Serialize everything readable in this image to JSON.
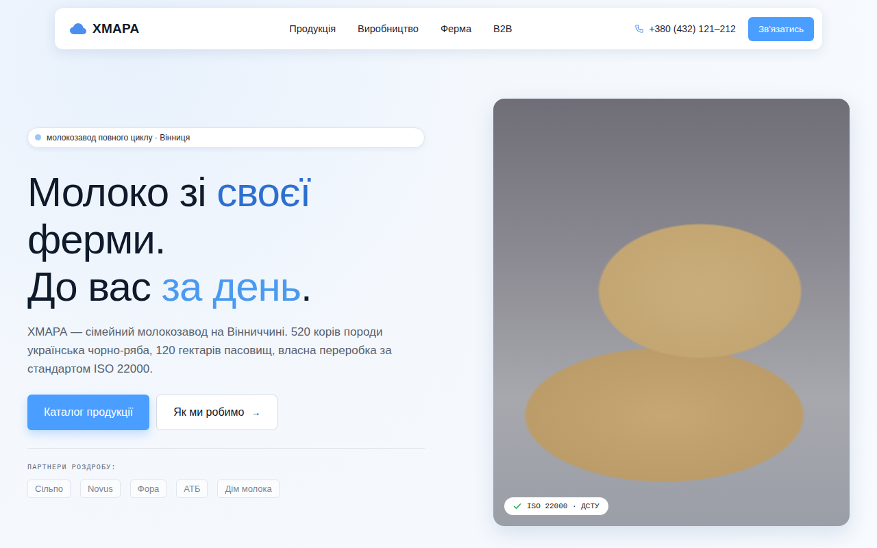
{
  "header": {
    "logo": "ХМАРА",
    "nav": [
      "Продукція",
      "Виробництво",
      "Ферма",
      "B2B"
    ],
    "phone": "+380 (432) 121–212",
    "cta": "Зв'язатись"
  },
  "hero": {
    "badge": "молокозавод повного циклу · Вінниця",
    "title": [
      [
        {
          "text": "Молоко зі ",
          "color": "#0f1a2b"
        },
        {
          "text": "своєї",
          "color": "#2d6fcf"
        }
      ],
      [
        {
          "text": "ферми.",
          "color": "#0f1a2b"
        }
      ],
      [
        {
          "text": "До вас ",
          "color": "#0f1a2b"
        },
        {
          "text": "за день",
          "color": "#4a9af0"
        },
        {
          "text": ".",
          "color": "#0f1a2b"
        }
      ]
    ],
    "description": "ХМАРА — сімейний молокозавод на Вінниччині. 520 корів породи українська чорно-ряба, 120 гектарів пасовищ, власна переробка за стандартом ISO 22000.",
    "primary_button": "Каталог продукції",
    "secondary_button": {
      "label": "Як ми робимо",
      "arrow": "→"
    },
    "partners_label": "ПАРТНЕРИ РОЗДРОБУ:",
    "partners": [
      "Сільпо",
      "Novus",
      "Фора",
      "АТБ",
      "Дім молока"
    ]
  },
  "photo": {
    "badge": "ISO 22000 · ДСТУ"
  }
}
